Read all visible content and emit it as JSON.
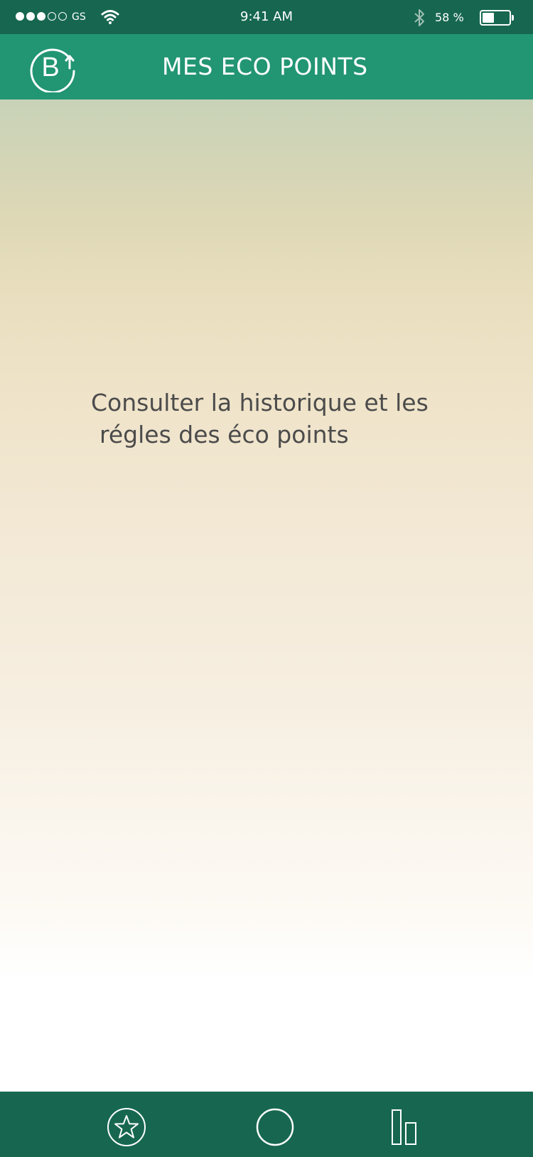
{
  "status_bar": {
    "carrier": "GS",
    "time": "9:41 AM",
    "battery_percent": "58 %",
    "battery_level": 0.45,
    "signal_bars_filled": 3,
    "signal_bars_total": 5
  },
  "header": {
    "title": "MES ECO POINTS",
    "logo_letter": "B"
  },
  "main": {
    "info_line1": "Consulter la historique et les",
    "info_line2": "régles des éco points"
  },
  "tab_bar": {
    "items": [
      {
        "icon": "star-icon"
      },
      {
        "icon": "circle-icon"
      },
      {
        "icon": "bar-chart-icon"
      }
    ]
  },
  "colors": {
    "status_bar": "#176750",
    "header": "#229573",
    "tab_bar": "#176750",
    "text": "#4b4b4b"
  }
}
